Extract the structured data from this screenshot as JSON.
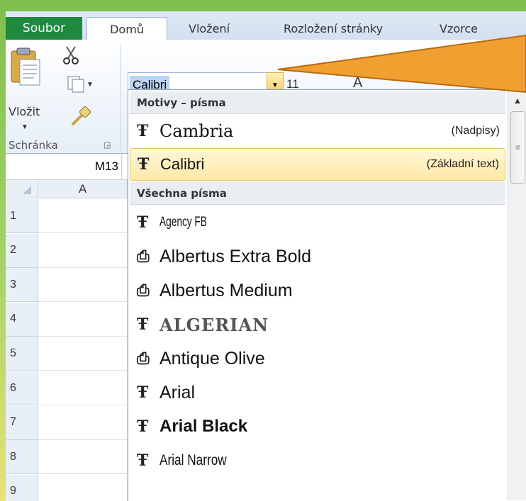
{
  "tabs": {
    "file": "Soubor",
    "home": "Domů",
    "insert": "Vložení",
    "layout": "Rozložení stránky",
    "formulas": "Vzorce"
  },
  "clipboard": {
    "paste": "Vložit",
    "group": "Schránka"
  },
  "font": {
    "current": "Calibri",
    "size": "11"
  },
  "namebox": "M13",
  "grid": {
    "col_a": "A",
    "rows": [
      "1",
      "2",
      "3",
      "4",
      "5",
      "6",
      "7",
      "8",
      "9"
    ]
  },
  "dropdown": {
    "theme_header": "Motivy – písma",
    "theme_items": [
      {
        "name": "Cambria",
        "tag": "(Nadpisy)"
      },
      {
        "name": "Calibri",
        "tag": "(Základní text)"
      }
    ],
    "all_header": "Všechna písma",
    "all_items": [
      {
        "name": "Agency FB"
      },
      {
        "name": "Albertus Extra Bold"
      },
      {
        "name": "Albertus Medium"
      },
      {
        "name": "ALGERIAN"
      },
      {
        "name": "Antique Olive"
      },
      {
        "name": "Arial"
      },
      {
        "name": "Arial Black"
      },
      {
        "name": "Arial Narrow"
      }
    ]
  },
  "colors": {
    "file_tab": "#1f8a3f",
    "highlight": "#ffe9a8",
    "callout": "#f0a030"
  }
}
